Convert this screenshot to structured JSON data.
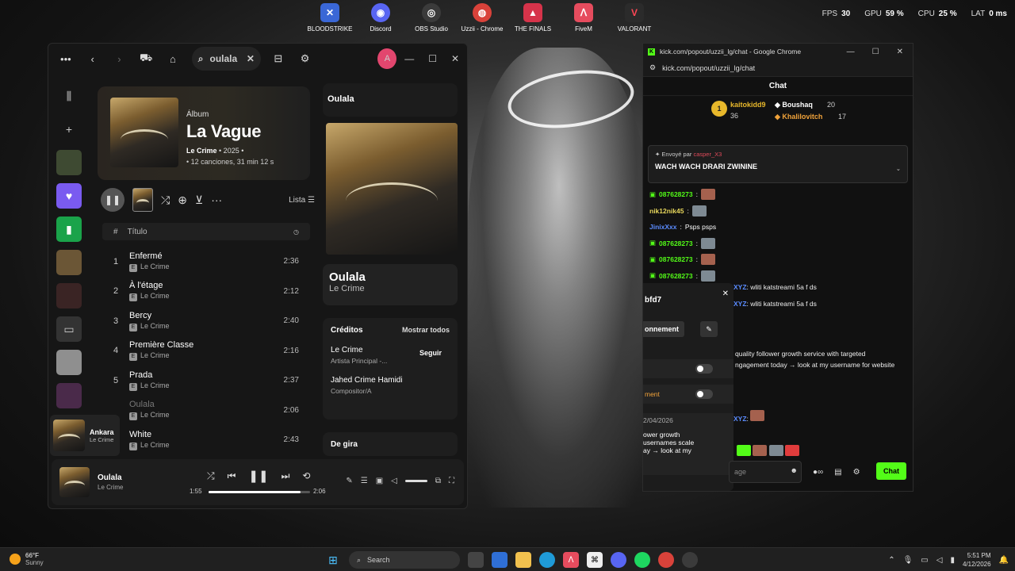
{
  "desktop": {
    "icons": [
      {
        "label": "BLOODSTRIKE",
        "glyph": "✕",
        "color": "#3a67d6"
      },
      {
        "label": "Discord",
        "glyph": "◉",
        "color": "#5865f2"
      },
      {
        "label": "OBS Studio",
        "glyph": "◎",
        "color": "#3b3b3b"
      },
      {
        "label": "Uzzii - Chrome",
        "glyph": "◍",
        "color": "#d9423a"
      },
      {
        "label": "THE FINALS",
        "glyph": "▲",
        "color": "#d6334a"
      },
      {
        "label": "FiveM",
        "glyph": "ᐱ",
        "color": "#e64c5e"
      },
      {
        "label": "VALORANT",
        "glyph": "V",
        "color": "#2b2b2b"
      }
    ],
    "stats": {
      "fps_label": "FPS",
      "fps": "30",
      "gpu_label": "GPU",
      "gpu": "59 %",
      "cpu_label": "CPU",
      "cpu": "25 %",
      "lat_label": "LAT",
      "lat": "0 ms"
    }
  },
  "spotify": {
    "search_value": "oulala",
    "avatar_letter": "A",
    "album": {
      "type": "Álbum",
      "title": "La Vague",
      "artist": "Le Crime",
      "year": "• 2025 •",
      "meta": "• 12 canciones, 31 min 12 s"
    },
    "list_label": "Lista",
    "header": {
      "num": "#",
      "title": "Título"
    },
    "tracks": [
      {
        "num": "1",
        "name": "Enfermé",
        "artist": "Le Crime",
        "duration": "2:36"
      },
      {
        "num": "2",
        "name": "À l'étage",
        "artist": "Le Crime",
        "duration": "2:12"
      },
      {
        "num": "3",
        "name": "Bercy",
        "artist": "Le Crime",
        "duration": "2:40"
      },
      {
        "num": "4",
        "name": "Première Classe",
        "artist": "Le Crime",
        "duration": "2:16"
      },
      {
        "num": "5",
        "name": "Prada",
        "artist": "Le Crime",
        "duration": "2:37"
      },
      {
        "num": "",
        "name": "Oulala",
        "artist": "Le Crime",
        "duration": "2:06"
      },
      {
        "num": "",
        "name": "White",
        "artist": "Le Crime",
        "duration": "2:43"
      }
    ],
    "now_playing_panel": {
      "heading": "Oulala",
      "song": "Oulala",
      "artist": "Le Crime",
      "credits_title": "Créditos",
      "show_all": "Mostrar todos",
      "credits": [
        {
          "name": "Le Crime",
          "role": "Artista Principal -...",
          "action": "Seguir"
        },
        {
          "name": "Jahed Crime Hamidi",
          "role": "Compositor/A",
          "action": ""
        }
      ],
      "tour": "De gira"
    },
    "queue_mini": {
      "title": "Ankara",
      "artist": "Le Crime"
    },
    "player": {
      "title": "Oulala",
      "artist": "Le Crime",
      "elapsed": "1:55",
      "total": "2:06",
      "progress": 0.91
    }
  },
  "chrome": {
    "window_title": "kick.com/popout/uzzii_lg/chat - Google Chrome",
    "url": "kick.com/popout/uzzii_lg/chat",
    "chat_heading": "Chat",
    "leaderboard": [
      {
        "rank": "1",
        "user": "kaitokidd9",
        "count": "36"
      },
      {
        "user": "Boushaq",
        "count": "20"
      },
      {
        "user": "Khalilovitch",
        "count": "17"
      }
    ],
    "pinned": {
      "sent_by": "Envoyé par",
      "by_user": "casper_X3",
      "message": "WACH WACH DRARI ZWININE"
    },
    "messages": [
      {
        "user": "087628273",
        "text": "",
        "color": "#53fc18"
      },
      {
        "user": "nik12nik45",
        "text": "",
        "color": "#e8d75c"
      },
      {
        "user": "JinixXxx",
        "text": "Psps psps",
        "color": "#5b8cff"
      },
      {
        "user": "087628273",
        "text": "",
        "color": "#53fc18"
      },
      {
        "user": "087628273",
        "text": "",
        "color": "#53fc18"
      },
      {
        "user": "087628273",
        "text": "",
        "color": "#53fc18"
      }
    ],
    "partial_lines": [
      {
        "user": "XYZ",
        "text": ": wliti katstreami 5a f ds"
      },
      {
        "user": "XYZ",
        "text": ": wliti katstreami 5a f ds"
      }
    ],
    "spam_text": [
      "quality follower growth service with targeted",
      "ngagement today → look at my username for website"
    ],
    "popup": {
      "id_fragment": "bfd7",
      "subscribe_fragment": "onnement",
      "toggle_label": "ment",
      "date": "2/04/2026",
      "preview": [
        "ower growth",
        "usernames scale",
        "ay → look at my"
      ]
    },
    "input_placeholder": "age",
    "chat_button": "Chat"
  },
  "taskbar": {
    "temp": "66°F",
    "condition": "Sunny",
    "search_placeholder": "Search",
    "time": "5:51 PM",
    "date": "4/12/2026"
  }
}
